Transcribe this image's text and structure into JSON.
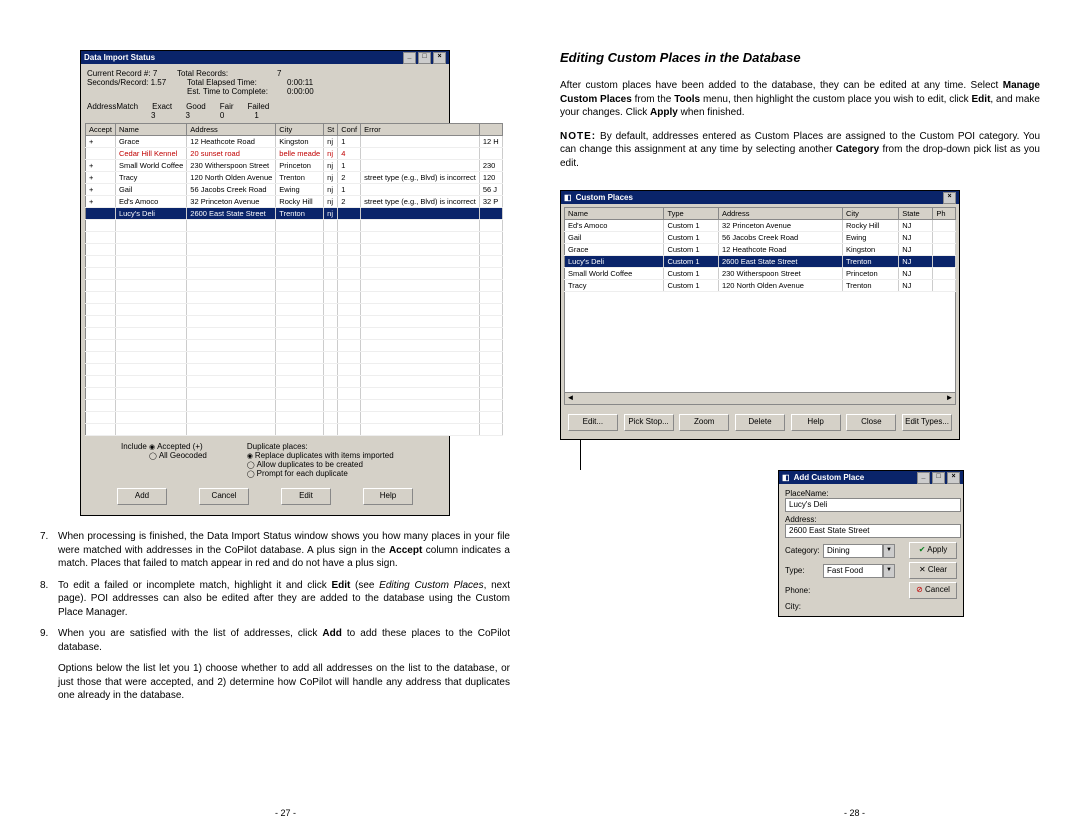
{
  "leftPage": {
    "importWindow": {
      "title": "Data Import Status",
      "stats": {
        "currentRecordLabel": "Current Record #:",
        "currentRecordVal": "7",
        "totalRecordsLabel": "Total Records:",
        "totalRecordsVal": "7",
        "secPerRecLabel": "Seconds/Record:",
        "secPerRecVal": "1.57",
        "totalElapsedLabel": "Total Elapsed Time:",
        "totalElapsedVal": "0:00:11",
        "estCompleteLabel": "Est. Time to Complete:",
        "estCompleteVal": "0:00:00",
        "addrMatchLabel": "AddressMatch",
        "exactLabel": "Exact",
        "exactVal": "3",
        "goodLabel": "Good",
        "goodVal": "3",
        "fairLabel": "Fair",
        "fairVal": "0",
        "failedLabel": "Failed",
        "failedVal": "1"
      },
      "gridHeaders": [
        "Accept",
        "Name",
        "Address",
        "City",
        "St",
        "Conf",
        "Error",
        ""
      ],
      "gridRows": [
        {
          "cells": [
            "+",
            "Grace",
            "12 Heathcote Road",
            "Kingston",
            "nj",
            "1",
            "",
            "12 H"
          ]
        },
        {
          "cells": [
            "",
            "Cedar Hill Kennel",
            "20 sunset road",
            "belle meade",
            "nj",
            "4",
            "",
            ""
          ],
          "err": true
        },
        {
          "cells": [
            "+",
            "Small World Coffee",
            "230 Witherspoon Street",
            "Princeton",
            "nj",
            "1",
            "",
            "230"
          ]
        },
        {
          "cells": [
            "+",
            "Tracy",
            "120 North Olden Avenue",
            "Trenton",
            "nj",
            "2",
            "street type (e.g., Blvd) is incorrect",
            "120"
          ]
        },
        {
          "cells": [
            "+",
            "Gail",
            "56 Jacobs Creek Road",
            "Ewing",
            "nj",
            "1",
            "",
            "56 J"
          ]
        },
        {
          "cells": [
            "+",
            "Ed's Amoco",
            "32 Princeton Avenue",
            "Rocky Hill",
            "nj",
            "2",
            "street type (e.g., Blvd) is incorrect",
            "32 P"
          ]
        },
        {
          "cells": [
            "",
            "Lucy's Deli",
            "2600 East State Street",
            "Trenton",
            "nj",
            "",
            "",
            ""
          ],
          "sel": true
        }
      ],
      "includeLabel": "Include",
      "includeOpt1": "Accepted (+)",
      "includeOpt2": "All Geocoded",
      "dupLabel": "Duplicate places:",
      "dupOpt1": "Replace duplicates with items imported",
      "dupOpt2": "Allow duplicates to be created",
      "dupOpt3": "Prompt for each duplicate",
      "btnAdd": "Add",
      "btnCancel": "Cancel",
      "btnEdit": "Edit",
      "btnHelp": "Help"
    },
    "para7num": "7.",
    "para7": "When processing is finished, the Data Import Status window shows you how many places in your file were matched with addresses in the CoPilot database. A plus sign in the ",
    "para7_accept": "Accept",
    "para7_after": " column indicates a match. Places that failed to match appear in red and do not have a plus sign.",
    "para8num": "8.",
    "para8_a": "To edit a failed or incomplete match, highlight it and click ",
    "para8_edit": "Edit",
    "para8_b": " (see ",
    "para8_i": "Editing Custom Places",
    "para8_c": ", next page). POI addresses can also be edited after they are added to the database using the Custom Place Manager.",
    "para9num": "9.",
    "para9_a": "When you are satisfied with the list of addresses, click ",
    "para9_add": "Add",
    "para9_b": " to add these places to the CoPilot database.",
    "para_opts": "Options below the list let you 1) choose whether to add all addresses on the list to the database, or just those that were accepted, and 2) determine how CoPilot will handle any address that duplicates one already in the database.",
    "pageNum": "- 27 -"
  },
  "rightPage": {
    "heading": "Editing Custom Places in the Database",
    "paraMain_a": "After custom places have been added to the database, they can be edited at any time. Select ",
    "paraMain_m1": "Manage Custom Places",
    "paraMain_b": " from the ",
    "paraMain_m2": "Tools",
    "paraMain_c": " menu, then highlight the custom place you wish to edit, click ",
    "paraMain_m3": "Edit",
    "paraMain_d": ", and make your changes. Click ",
    "paraMain_m4": "Apply",
    "paraMain_e": " when finished.",
    "noteLabel": "NOTE:",
    "note_a": " By default, addresses entered as Custom Places are assigned to the Custom POI category. You can change this assignment at any time by selecting another ",
    "note_cat": "Category",
    "note_b": " from the drop-down pick list as you edit.",
    "customPlacesWindow": {
      "title": "Custom Places",
      "headers": [
        "Name",
        "Type",
        "Address",
        "City",
        "State",
        "Ph"
      ],
      "rows": [
        {
          "cells": [
            "Ed's Amoco",
            "Custom 1",
            "32 Princeton Avenue",
            "Rocky Hill",
            "NJ",
            ""
          ]
        },
        {
          "cells": [
            "Gail",
            "Custom 1",
            "56 Jacobs Creek Road",
            "Ewing",
            "NJ",
            ""
          ]
        },
        {
          "cells": [
            "Grace",
            "Custom 1",
            "12 Heathcote Road",
            "Kingston",
            "NJ",
            ""
          ]
        },
        {
          "cells": [
            "Lucy's Deli",
            "Custom 1",
            "2600 East State Street",
            "Trenton",
            "NJ",
            ""
          ],
          "sel": true
        },
        {
          "cells": [
            "Small World Coffee",
            "Custom 1",
            "230 Witherspoon Street",
            "Princeton",
            "NJ",
            ""
          ]
        },
        {
          "cells": [
            "Tracy",
            "Custom 1",
            "120 North Olden Avenue",
            "Trenton",
            "NJ",
            ""
          ]
        }
      ],
      "btnEdit": "Edit...",
      "btnPick": "Pick Stop...",
      "btnZoom": "Zoom",
      "btnDelete": "Delete",
      "btnHelp": "Help",
      "btnClose": "Close",
      "btnEditTypes": "Edit Types..."
    },
    "addCustomWindow": {
      "title": "Add Custom Place",
      "placeNameLabel": "PlaceName:",
      "placeNameVal": "Lucy's Deli",
      "addressLabel": "Address:",
      "addressVal": "2600 East State Street",
      "categoryLabel": "Category:",
      "categoryVal": "Dining",
      "typeLabel": "Type:",
      "typeVal": "Fast Food",
      "phoneLabel": "Phone:",
      "cityLabel": "City:",
      "btnApply": "Apply",
      "btnClear": "Clear",
      "btnCancel": "Cancel",
      "checkColor": "#0a8020",
      "xColor": "#000",
      "cancelIconColor": "#c00000"
    },
    "pageNum": "- 28 -"
  }
}
